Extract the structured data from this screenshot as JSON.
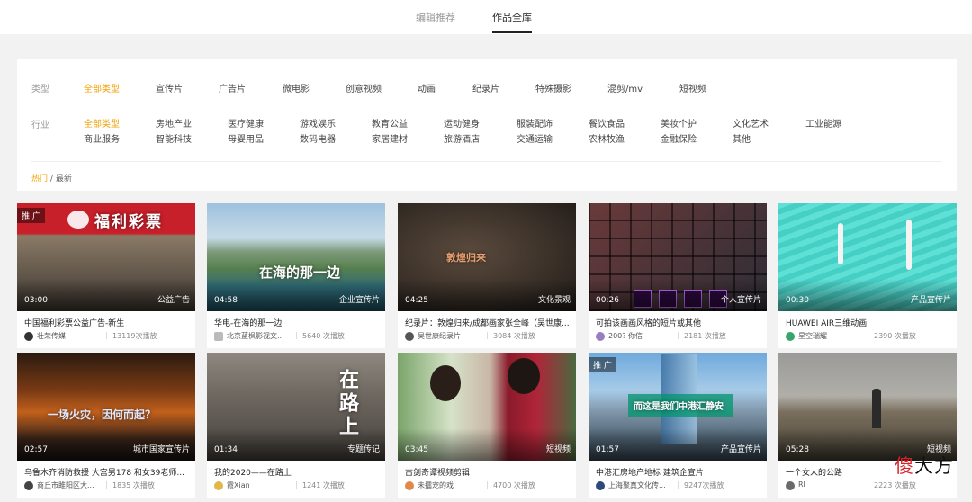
{
  "tabs": [
    {
      "label": "编辑推荐",
      "active": false
    },
    {
      "label": "作品全库",
      "active": true
    }
  ],
  "filters": {
    "type_label": "类型",
    "type_items": [
      "全部类型",
      "宣传片",
      "广告片",
      "微电影",
      "创意视频",
      "动画",
      "纪录片",
      "特殊摄影",
      "混剪/mv",
      "短视频"
    ],
    "industry_label": "行业",
    "industry_row1": [
      "全部类型",
      "房地产业",
      "医疗健康",
      "游戏娱乐",
      "教育公益",
      "运动健身",
      "服装配饰",
      "餐饮食品",
      "美妆个护",
      "文化艺术",
      "工业能源"
    ],
    "industry_row2": [
      "商业服务",
      "智能科技",
      "母婴用品",
      "数码电器",
      "家居建材",
      "旅游酒店",
      "交通运输",
      "农林牧渔",
      "金融保险",
      "其他"
    ],
    "active_color": "#f0a100"
  },
  "breadcrumb": {
    "hot": "热门",
    "separator": "/",
    "latest": "最新"
  },
  "cards": [
    {
      "title": "中国福利彩票公益广告-新生",
      "author": "壮荣传媒",
      "plays": "13119次播放",
      "duration": "03:00",
      "category": "公益广告",
      "badge": "推 广",
      "overlay": "福利彩票"
    },
    {
      "title": "华电-在海的那一边",
      "author": "北京蓝枫影视文...",
      "plays": "5640 次播放",
      "duration": "04:58",
      "category": "企业宣传片",
      "overlay": "在海的那一边"
    },
    {
      "title": "纪录片：敦煌归来/成都画家张全峰（吴世康...",
      "author": "吴世康纪录片",
      "plays": "3084 次播放",
      "duration": "04:25",
      "category": "文化景观",
      "overlay": "敦煌归来"
    },
    {
      "title": "可拍该画画风格的短片或其他",
      "author": "200? 你信",
      "plays": "2181 次播放",
      "duration": "00:26",
      "category": "个人宣传片"
    },
    {
      "title": "HUAWEI AIR三维动画",
      "author": "星空瑞耀",
      "plays": "2390 次播放",
      "duration": "00:30",
      "category": "产品宣传片"
    },
    {
      "title": "乌鲁木齐消防救援 大宫男178 和女39老师...",
      "author": "商丘市雎阳区大...",
      "plays": "1835 次播放",
      "duration": "02:57",
      "category": "城市国家宣传片",
      "overlay": "一场火灾，因何而起？"
    },
    {
      "title": "我的2020——在路上",
      "author": "霞Xian",
      "plays": "1241 次播放",
      "duration": "01:34",
      "category": "专题传记",
      "overlay": "在路上"
    },
    {
      "title": "古剑奇谭视频剪辑",
      "author": "未擂宠的戏",
      "plays": "4700 次播放",
      "duration": "03:45",
      "category": "短视频"
    },
    {
      "title": "中港汇房地产地标 建筑企宣片",
      "author": "上海聚真文化传...",
      "plays": "9247次播放",
      "duration": "01:57",
      "category": "产品宣传片",
      "badge": "推 广",
      "overlay": "而这是我们中港汇静安"
    },
    {
      "title": "一个女人的公路",
      "author": "RI",
      "plays": "2223 次播放",
      "duration": "05:28",
      "category": "短视频"
    }
  ],
  "watermark": {
    "part1": "傻",
    "part2": "大方"
  }
}
